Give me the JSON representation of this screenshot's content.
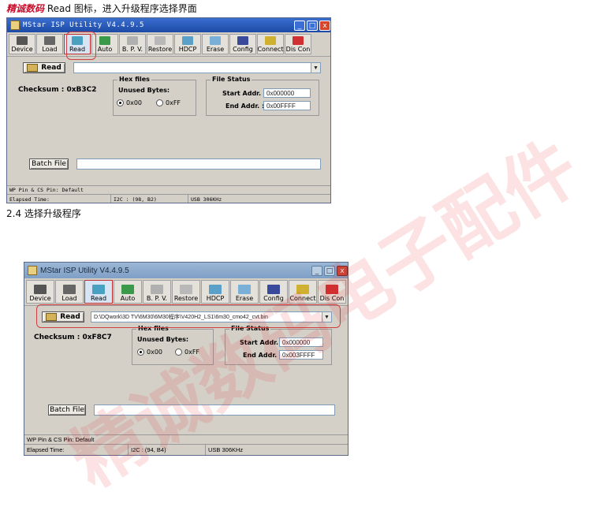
{
  "doc": {
    "brand": "精诚数码",
    "intro": " Read  图标，进入升级程序选择界面",
    "section": "2.4  选择升级程序"
  },
  "watermark": "精诚数码电子配件",
  "win1": {
    "title": "MStar ISP Utility V4.4.9.5",
    "tools": [
      {
        "label": "Device",
        "icon": "device-icon",
        "color": "#555555"
      },
      {
        "label": "Load",
        "icon": "load-icon",
        "color": "#666666"
      },
      {
        "label": "Read",
        "icon": "read-icon",
        "color": "#4aa0c0"
      },
      {
        "label": "Auto",
        "icon": "auto-icon",
        "color": "#3a9a4a"
      },
      {
        "label": "B. P. V.",
        "icon": "bpv-icon",
        "color": "#b0b0b0"
      },
      {
        "label": "Restore",
        "icon": "restore-icon",
        "color": "#b8b8b8"
      },
      {
        "label": "HDCP",
        "icon": "hdcp-icon",
        "color": "#5aa0c8"
      },
      {
        "label": "Erase",
        "icon": "erase-icon",
        "color": "#7ab0d8"
      },
      {
        "label": "Config",
        "icon": "config-icon",
        "color": "#3a4a9a"
      },
      {
        "label": "Connect",
        "icon": "connect-icon",
        "color": "#d0b030"
      },
      {
        "label": "Dis Con",
        "icon": "disconnect-icon",
        "color": "#d03030"
      }
    ],
    "read_button": "Read",
    "file_path": "",
    "checksum": "Checksum : 0xB3C2",
    "hex_files": "Hex files",
    "unused_bytes": "Unused Bytes:",
    "opt_00": "0x00",
    "opt_ff": "0xFF",
    "file_status": "File Status",
    "start_label": "Start Addr. :",
    "start_value": "0x000000",
    "end_label": "End Addr. :",
    "end_value": "0x00FFFF",
    "batch_file": "Batch File",
    "status_wp": "WP Pin & CS Pin: Default",
    "status_elapsed": "Elapsed Time:",
    "status_i2c": "I2C : (98, B2)",
    "status_usb": "USB  306KHz"
  },
  "win2": {
    "title": "MStar ISP Utility V4.4.9.5",
    "read_button": "Read",
    "file_path": "D:\\DQwork\\3D TV\\6M30\\6M30程序\\V420H2_LS1\\6m30_cmo42_cvt.bin",
    "checksum": "Checksum : 0xF8C7",
    "hex_files": "Hex files",
    "unused_bytes": "Unused Bytes:",
    "opt_00": "0x00",
    "opt_ff": "0xFF",
    "file_status": "File Status",
    "start_label": "Start Addr. :",
    "start_value": "0x000000",
    "end_label": "End Addr. :",
    "end_value": "0x003FFFF",
    "batch_file": "Batch File",
    "status_wp": "WP Pin & CS Pin: Default",
    "status_elapsed": "Elapsed Time:",
    "status_i2c": "I2C : (94, B4)",
    "status_usb": "USB  306KHz"
  }
}
